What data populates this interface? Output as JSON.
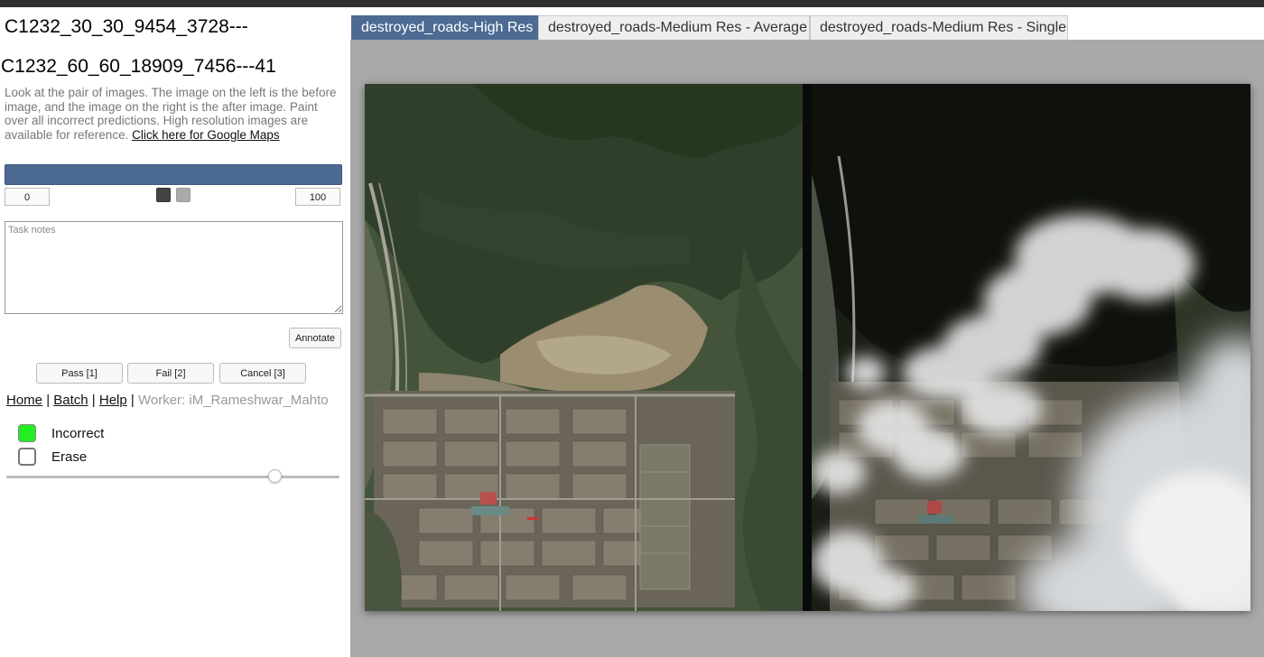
{
  "task": {
    "title_primary": "C1232_30_30_9454_3728---",
    "title_secondary": "C1232_60_60_18909_7456---41",
    "instructions": "Look at the pair of images. The image on the left is the before image, and the image on the right is the after image. Paint over all incorrect predictions. High resolution images are available for reference.",
    "maps_link": "Click here for Google Maps"
  },
  "range": {
    "min": "0",
    "max": "100",
    "bar_color": "#4c6a92",
    "swatch_dark": "#444444",
    "swatch_light": "#aaaaaa"
  },
  "notes": {
    "placeholder": "Task notes"
  },
  "buttons": {
    "annotate": "Annotate",
    "pass": "Pass [1]",
    "fail": "Fail [2]",
    "cancel": "Cancel [3]"
  },
  "nav": {
    "home": "Home",
    "batch": "Batch",
    "help": "Help",
    "separator": "|",
    "worker": "Worker: iM_Rameshwar_Mahto"
  },
  "legend": {
    "incorrect_label": "Incorrect",
    "incorrect_color": "#22ee22",
    "erase_label": "Erase"
  },
  "brush": {
    "level_fraction": 0.81
  },
  "tabs": [
    {
      "label": "destroyed_roads-High Res",
      "active": true
    },
    {
      "label": "destroyed_roads-Medium Res - Average",
      "active": false
    },
    {
      "label": "destroyed_roads-Medium Res - Single",
      "active": false
    }
  ],
  "images": {
    "before": "before-image",
    "after": "after-image"
  }
}
